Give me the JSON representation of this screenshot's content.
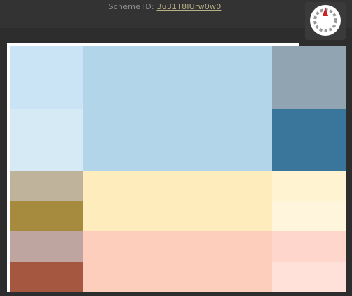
{
  "header": {
    "scheme_label": "Scheme ID: ",
    "scheme_id": "3u31T8lUrw0w0",
    "wheel_icon": "color-wheel-icon"
  },
  "colors": {
    "app_background": "#2b2b2b",
    "topbar": "#333333",
    "blue_primary": "#b3d5ea",
    "blue_light": "#cae4f5",
    "blue_pale": "#d6eaf6",
    "blue_gray": "#90a4b2",
    "blue_dark": "#3a759b",
    "yellow_primary": "#ffecbd",
    "yellow_light": "#fff3d2",
    "yellow_pale": "#fff4dc",
    "tan": "#bfb39b",
    "olive": "#a68b3e",
    "salmon_primary": "#fecebd",
    "salmon_light": "#ffd6cc",
    "salmon_pale": "#ffe1d9",
    "rose_gray": "#bfa59f",
    "brick": "#a65740",
    "wheel_marker": "#cc2222"
  }
}
